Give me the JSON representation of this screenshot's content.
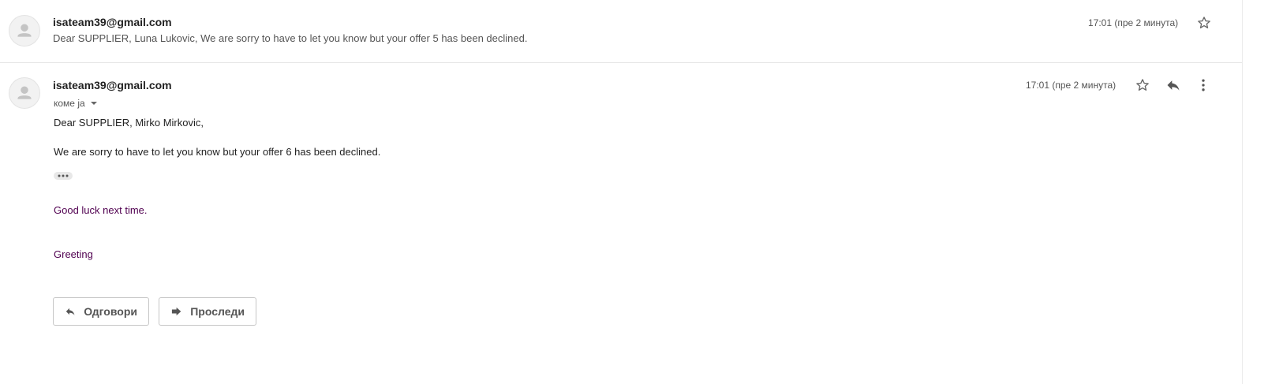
{
  "collapsed_message": {
    "sender": "isateam39@gmail.com",
    "snippet": "Dear SUPPLIER, Luna Lukovic, We are sorry to have to let you know but your offer 5 has been declined.",
    "time": "17:01 (пре 2 минута)"
  },
  "expanded_message": {
    "sender": "isateam39@gmail.com",
    "to_label": "коме ја",
    "time": "17:01 (пре 2 минута)",
    "greeting_line": "Dear SUPPLIER, Mirko Mirkovic,",
    "body_line": "We are sorry to have to let you know but your offer 6 has been declined.",
    "closing_line": "Good luck next time.",
    "signature": "Greeting"
  },
  "actions": {
    "reply_label": "Одговори",
    "forward_label": "Проследи"
  },
  "icons": {
    "avatar": "default-person-icon",
    "star": "star-outline-icon",
    "reply": "reply-arrow-icon",
    "more": "vertical-dots-icon",
    "dropdown": "caret-down-icon",
    "forward": "forward-arrow-icon"
  },
  "colors": {
    "purple_text": "#500050",
    "divider": "#e5e5e5"
  }
}
